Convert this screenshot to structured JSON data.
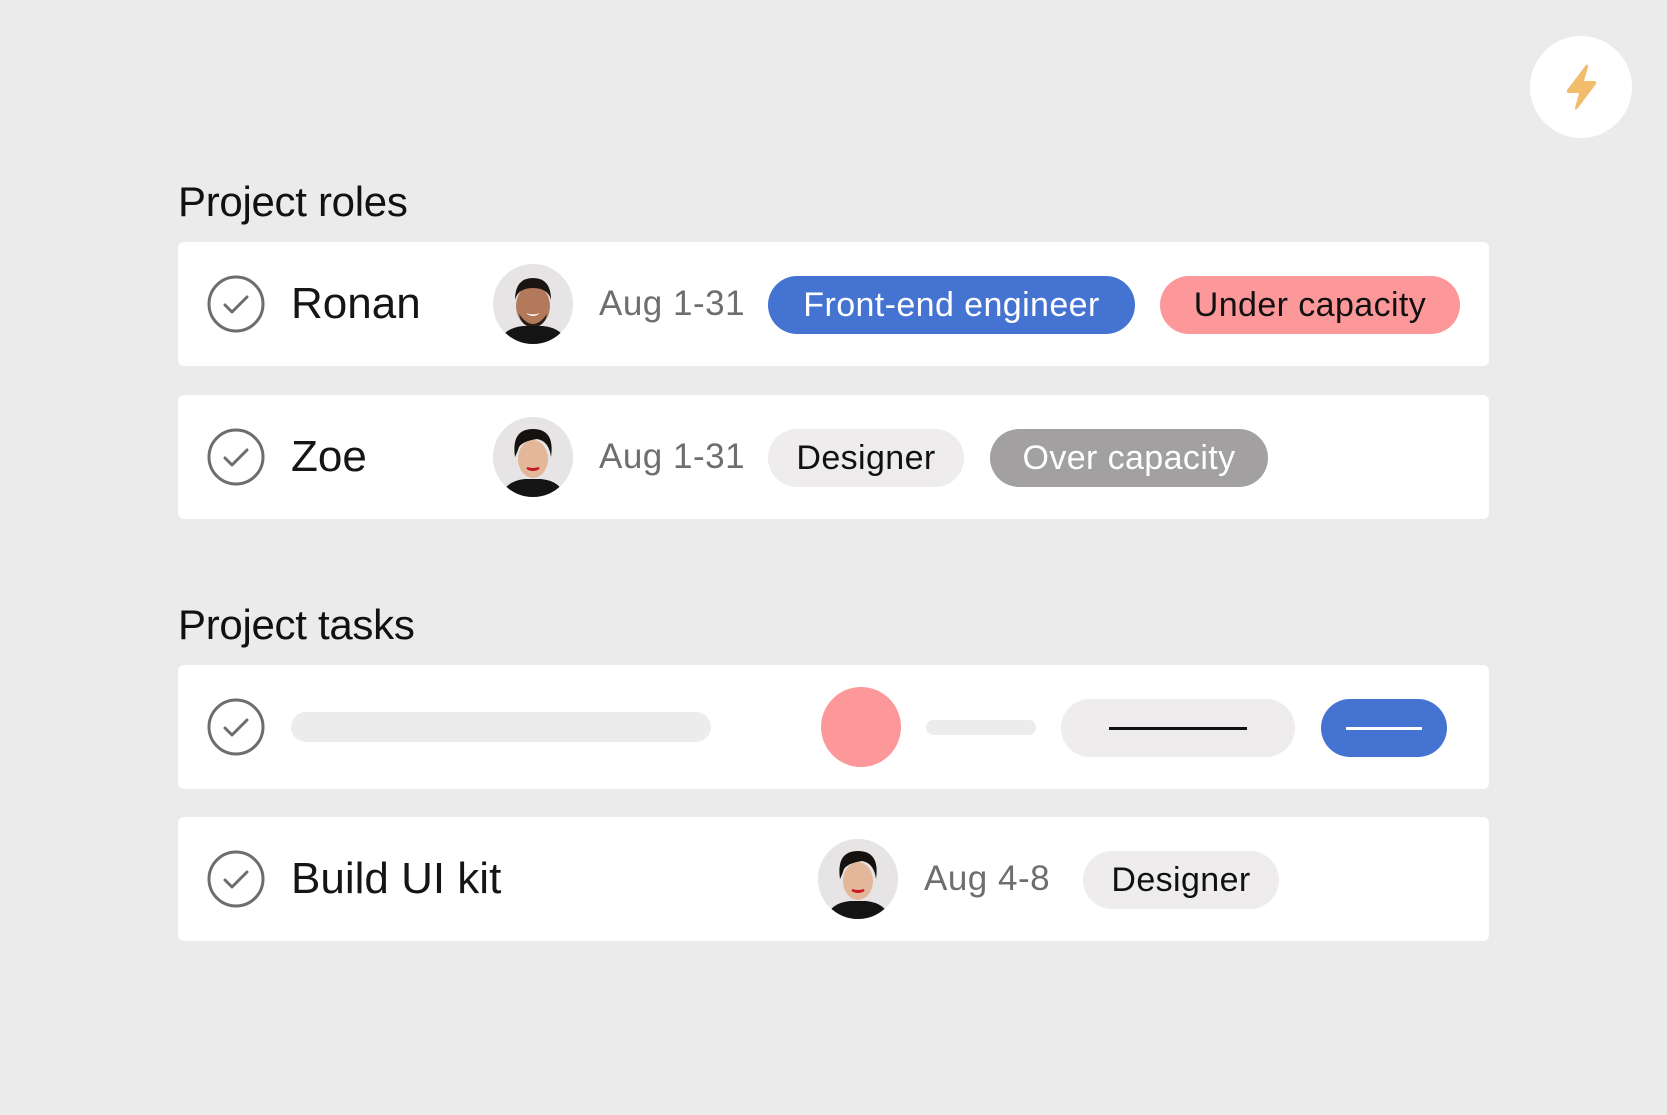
{
  "quick_action": {
    "icon": "lightning-bolt-icon",
    "color": "#f1bd6c"
  },
  "sections": {
    "roles": {
      "title": "Project roles",
      "rows": [
        {
          "name": "Ronan",
          "avatar": "Ronan",
          "dates": "Aug 1-31",
          "role": "Front-end engineer",
          "role_color": "#4573d2",
          "capacity": "Under capacity",
          "capacity_color": "#fc979a"
        },
        {
          "name": "Zoe",
          "avatar": "Zoe",
          "dates": "Aug 1-31",
          "role": "Designer",
          "role_color": "#eeecec",
          "capacity": "Over capacity",
          "capacity_color": "#a2a0a1"
        }
      ]
    },
    "tasks": {
      "title": "Project tasks",
      "rows": [
        {
          "placeholder": true
        },
        {
          "name": "Build UI kit",
          "avatar": "Zoe",
          "dates": "Aug 4-8",
          "role": "Designer"
        }
      ]
    }
  }
}
